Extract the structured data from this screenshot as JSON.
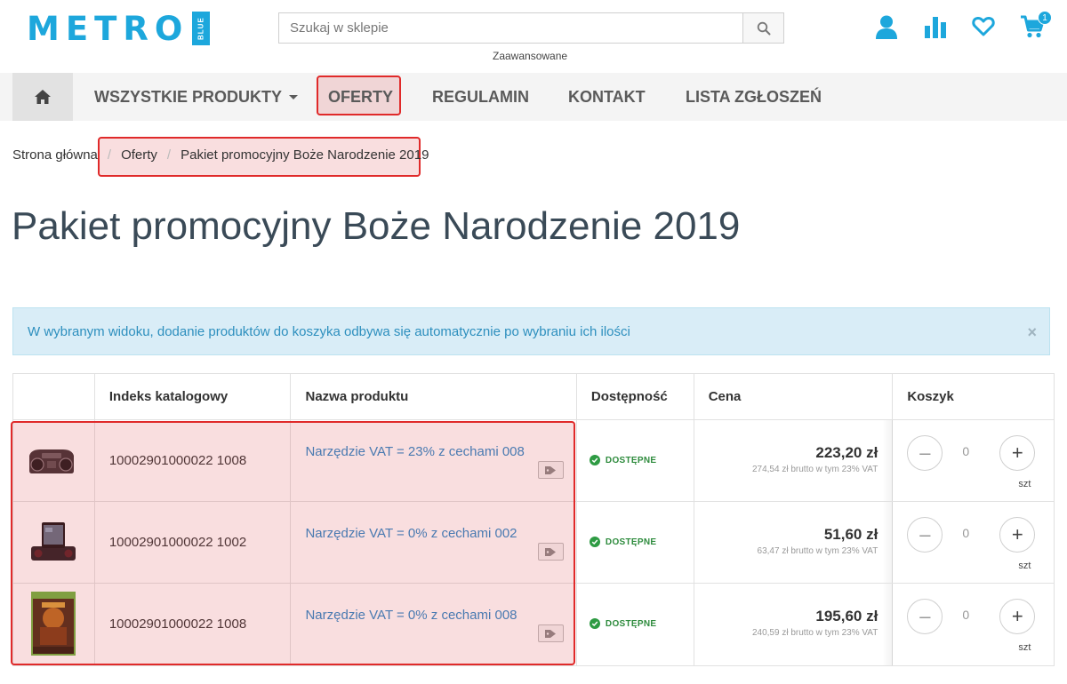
{
  "header": {
    "logo_text": "METRO",
    "logo_tag": "BLUE",
    "search_placeholder": "Szukaj w sklepie",
    "advanced_link": "Zaawansowane",
    "cart_count": "1",
    "accent_color": "#1da7dc"
  },
  "nav": {
    "items": [
      {
        "label": "WSZYSTKIE PRODUKTY"
      },
      {
        "label": "OFERTY"
      },
      {
        "label": "REGULAMIN"
      },
      {
        "label": "KONTAKT"
      },
      {
        "label": "LISTA ZGŁOSZEŃ"
      }
    ]
  },
  "breadcrumb": {
    "items": [
      "Strona główna",
      "Oferty",
      "Pakiet promocyjny Boże Narodzenie 2019"
    ]
  },
  "page_title": "Pakiet promocyjny Boże Narodzenie 2019",
  "alert": {
    "text": "W wybranym widoku, dodanie produktów do koszyka odbywa się automatycznie po wybraniu ich ilości",
    "close": "×"
  },
  "table": {
    "headers": [
      "",
      "Indeks katalogowy",
      "Nazwa produktu",
      "Dostępność",
      "Cena",
      "Koszyk"
    ],
    "rows": [
      {
        "image_icon": "boombox-icon",
        "index": "10002901000022 1008",
        "name": "Narzędzie VAT = 23% z cechami 008",
        "availability": "DOSTĘPNE",
        "price": "223,20 zł",
        "price_note": "274,54 zł brutto w tym 23% VAT",
        "qty": "0",
        "unit": "szt"
      },
      {
        "image_icon": "speaker-dock-icon",
        "index": "10002901000022 1002",
        "name": "Narzędzie VAT = 0% z cechami 002",
        "availability": "DOSTĘPNE",
        "price": "51,60 zł",
        "price_note": "63,47 zł brutto w tym 23% VAT",
        "qty": "0",
        "unit": "szt"
      },
      {
        "image_icon": "game-cover-icon",
        "index": "10002901000022 1008",
        "name": "Narzędzie VAT = 0% z cechami 008",
        "availability": "DOSTĘPNE",
        "price": "195,60 zł",
        "price_note": "240,59 zł brutto w tym 23% VAT",
        "qty": "0",
        "unit": "szt"
      }
    ]
  }
}
